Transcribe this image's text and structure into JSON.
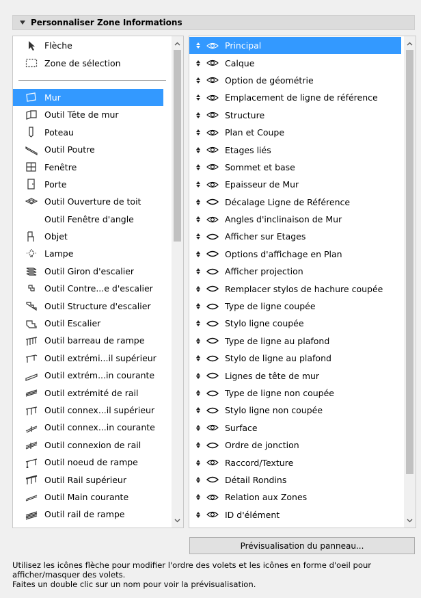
{
  "header": {
    "title": "Personnaliser Zone Informations"
  },
  "tools": {
    "top": [
      {
        "label": "Flèche",
        "icon": "arrow-pointer-icon"
      },
      {
        "label": "Zone de sélection",
        "icon": "marquee-icon"
      }
    ],
    "items": [
      {
        "label": "Mur",
        "icon": "wall-icon",
        "selected": true
      },
      {
        "label": "Outil Tête de mur",
        "icon": "wall-end-icon"
      },
      {
        "label": "Poteau",
        "icon": "column-icon"
      },
      {
        "label": "Outil Poutre",
        "icon": "beam-icon"
      },
      {
        "label": "Fenêtre",
        "icon": "window-icon"
      },
      {
        "label": "Porte",
        "icon": "door-icon"
      },
      {
        "label": "Outil Ouverture de toit",
        "icon": "roof-opening-icon"
      },
      {
        "label": "Outil Fenêtre d'angle",
        "icon": ""
      },
      {
        "label": "Objet",
        "icon": "chair-icon"
      },
      {
        "label": "Lampe",
        "icon": "lamp-icon"
      },
      {
        "label": "Outil Giron d'escalier",
        "icon": "stair-tread-icon"
      },
      {
        "label": "Outil Contre...e d'escalier",
        "icon": "stair-riser-icon"
      },
      {
        "label": "Outil Structure d'escalier",
        "icon": "stair-structure-icon"
      },
      {
        "label": "Outil Escalier",
        "icon": "stair-icon"
      },
      {
        "label": "Outil barreau de rampe",
        "icon": "railing-baluster-icon"
      },
      {
        "label": "Outil extrémi...il supérieur",
        "icon": "toprail-end-icon"
      },
      {
        "label": "Outil extrém...in courante",
        "icon": "handrail-end-icon"
      },
      {
        "label": "Outil extrémité de rail",
        "icon": "rail-end-icon"
      },
      {
        "label": "Outil connex...il supérieur",
        "icon": "toprail-connection-icon"
      },
      {
        "label": "Outil connex...in courante",
        "icon": "handrail-connection-icon"
      },
      {
        "label": "Outil connexion de rail",
        "icon": "rail-connection-icon"
      },
      {
        "label": "Outil noeud de rampe",
        "icon": "railing-node-icon"
      },
      {
        "label": "Outil Rail supérieur",
        "icon": "toprail-icon"
      },
      {
        "label": "Outil Main courante",
        "icon": "handrail-icon"
      },
      {
        "label": "Outil rail de rampe",
        "icon": "rail-icon"
      }
    ]
  },
  "panels": [
    {
      "label": "Principal",
      "visible": true,
      "selected": true
    },
    {
      "label": "Calque",
      "visible": true
    },
    {
      "label": "Option de géométrie",
      "visible": true
    },
    {
      "label": "Emplacement de ligne de référence",
      "visible": true
    },
    {
      "label": "Structure",
      "visible": true
    },
    {
      "label": "Plan et Coupe",
      "visible": true
    },
    {
      "label": "Etages liés",
      "visible": true
    },
    {
      "label": "Sommet et base",
      "visible": true
    },
    {
      "label": "Epaisseur de Mur",
      "visible": true
    },
    {
      "label": "Décalage Ligne de Référence",
      "visible": false
    },
    {
      "label": "Angles d'inclinaison de Mur",
      "visible": true
    },
    {
      "label": "Afficher sur Etages",
      "visible": false
    },
    {
      "label": "Options d'affichage en Plan",
      "visible": false
    },
    {
      "label": "Afficher projection",
      "visible": false
    },
    {
      "label": "Remplacer stylos de hachure coupée",
      "visible": false
    },
    {
      "label": "Type de ligne coupée",
      "visible": false
    },
    {
      "label": "Stylo ligne coupée",
      "visible": false
    },
    {
      "label": "Type de ligne au plafond",
      "visible": false
    },
    {
      "label": "Stylo de ligne au plafond",
      "visible": false
    },
    {
      "label": "Lignes de tête de mur",
      "visible": false
    },
    {
      "label": "Type de ligne non coupée",
      "visible": false
    },
    {
      "label": "Stylo ligne non coupée",
      "visible": false
    },
    {
      "label": "Surface",
      "visible": true
    },
    {
      "label": "Ordre de jonction",
      "visible": false
    },
    {
      "label": "Raccord/Texture",
      "visible": true
    },
    {
      "label": "Détail Rondins",
      "visible": false
    },
    {
      "label": "Relation aux Zones",
      "visible": true
    },
    {
      "label": "ID d'élément",
      "visible": true
    }
  ],
  "preview_button": "Prévisualisation du panneau...",
  "help": {
    "line1": "Utilisez les icônes flèche pour modifier l'ordre des volets et les icônes en forme d'oeil pour afficher/masquer des volets.",
    "line2": "Faites un double clic sur un nom pour voir la prévisualisation."
  },
  "colors": {
    "selection": "#3399ff",
    "header_bg": "#dcdcdc",
    "window_bg": "#f0f0f0"
  }
}
